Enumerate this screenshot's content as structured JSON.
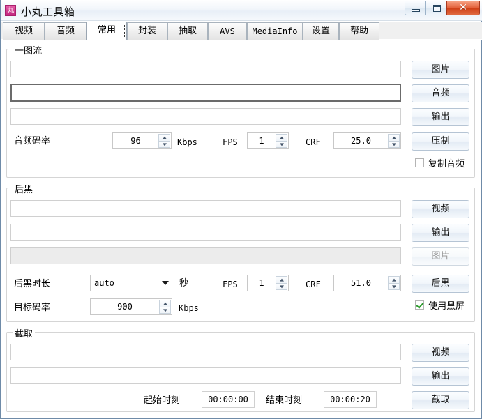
{
  "window": {
    "title": "小丸工具箱",
    "icon": "丸",
    "buttons": {
      "minimize": "minimize",
      "maximize": "maximize",
      "close": "✕"
    }
  },
  "tabs": [
    {
      "label": "视频",
      "selected": false,
      "mono": false
    },
    {
      "label": "音频",
      "selected": false,
      "mono": false
    },
    {
      "label": "常用",
      "selected": true,
      "mono": false
    },
    {
      "label": "封装",
      "selected": false,
      "mono": false
    },
    {
      "label": "抽取",
      "selected": false,
      "mono": false
    },
    {
      "label": "AVS",
      "selected": false,
      "mono": true
    },
    {
      "label": "MediaInfo",
      "selected": false,
      "mono": true
    },
    {
      "label": "设置",
      "selected": false,
      "mono": false
    },
    {
      "label": "帮助",
      "selected": false,
      "mono": false
    }
  ],
  "groups": {
    "onepic": {
      "title": "一图流",
      "rows": {
        "image_path": "",
        "audio_path": "",
        "output_path": ""
      },
      "buttons": {
        "image": "图片",
        "audio": "音频",
        "output": "输出",
        "encode": "压制"
      },
      "labels": {
        "audio_bitrate": "音频码率",
        "kbps": "Kbps",
        "fps": "FPS",
        "crf": "CRF"
      },
      "values": {
        "audio_bitrate": "96",
        "fps": "1",
        "crf": "25.0"
      },
      "checkbox": {
        "label": "复制音频",
        "checked": false
      }
    },
    "blacktail": {
      "title": "后黑",
      "rows": {
        "video_path": "",
        "output_path": "",
        "image_path": ""
      },
      "buttons": {
        "video": "视频",
        "output": "输出",
        "image": "图片",
        "run": "后黑"
      },
      "labels": {
        "duration": "后黑时长",
        "seconds": "秒",
        "fps": "FPS",
        "crf": "CRF",
        "target_bitrate": "目标码率",
        "kbps": "Kbps"
      },
      "values": {
        "duration": "auto",
        "fps": "1",
        "crf": "51.0",
        "target_bitrate": "900"
      },
      "checkbox": {
        "label": "使用黑屏",
        "checked": true
      }
    },
    "cut": {
      "title": "截取",
      "rows": {
        "video_path": "",
        "output_path": ""
      },
      "buttons": {
        "video": "视频",
        "output": "输出",
        "run": "截取"
      },
      "labels": {
        "start_time": "起始时刻",
        "end_time": "结束时刻"
      },
      "values": {
        "start_time": "00:00:00",
        "end_time": "00:00:20"
      }
    }
  },
  "colors": {
    "accent": "#c2257e",
    "close_button": "#cf3f16",
    "check_green": "#2e9c2e"
  }
}
